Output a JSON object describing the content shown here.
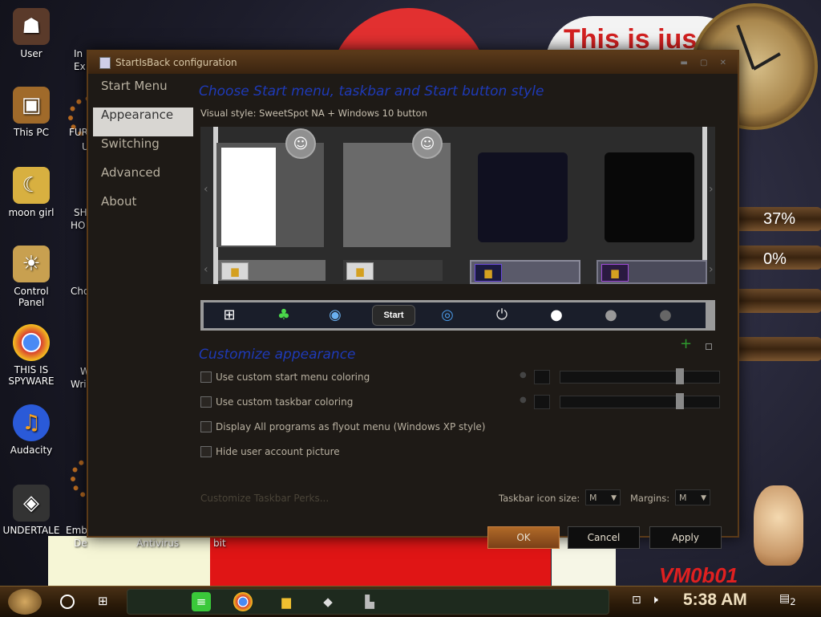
{
  "desktop": {
    "icons_left": [
      {
        "label": "User",
        "icon": "user-folder-icon",
        "color": "#5a3a2a"
      },
      {
        "label": "This PC",
        "icon": "this-pc-icon",
        "color": "#a06a2a"
      },
      {
        "label": "moon girl",
        "icon": "moon-girl-icon",
        "color": "#d8b040"
      },
      {
        "label": "Control Panel",
        "icon": "control-panel-icon",
        "color": "#c8a050"
      },
      {
        "label": "THIS IS SPYWARE",
        "icon": "chrome-icon",
        "color": "#2a8a3a"
      },
      {
        "label": "Audacity",
        "icon": "audacity-icon",
        "color": "#2a5ad8"
      },
      {
        "label": "UNDERTALE",
        "icon": "unity-icon",
        "color": "#333333"
      }
    ],
    "partial_labels": [
      "In",
      "Ex",
      "FUR",
      "U",
      "SH",
      "HO",
      "Cho",
      "W",
      "Wri",
      "Emb",
      "De",
      "Antivirus",
      "bit"
    ],
    "wallpaper_text": "This is jus",
    "gauge_values": [
      "37%",
      "0%"
    ],
    "vm_text": "VM0b01"
  },
  "dialog": {
    "title": "StartIsBack configuration",
    "nav": [
      "Start Menu",
      "Appearance",
      "Switching",
      "Advanced",
      "About"
    ],
    "active_nav": "Appearance",
    "section1_title": "Choose Start menu, taskbar and Start button style",
    "visual_style_line": "Visual style:  SweetSpot NA + Windows 10 button",
    "start_button_styles": [
      "windows-10-flag",
      "clover-orb",
      "windows-7-orb",
      "start-xp",
      "ring-orb",
      "power-icon",
      "white-orb",
      "gray-orb",
      "dark-orb"
    ],
    "start_label": "Start",
    "section2_title": "Customize appearance",
    "options": [
      {
        "label": "Use custom start menu coloring",
        "checked": false
      },
      {
        "label": "Use custom taskbar coloring",
        "checked": false
      },
      {
        "label": "Display All programs as flyout menu (Windows XP style)",
        "checked": false
      },
      {
        "label": "Hide user account picture",
        "checked": false
      }
    ],
    "perks_link": "Customize Taskbar Perks...",
    "icon_size_label": "Taskbar icon size:",
    "icon_size_value": "M",
    "margins_label": "Margins:",
    "margins_value": "M",
    "ok_label": "OK",
    "cancel_label": "Cancel",
    "apply_label": "Apply"
  },
  "taskbar": {
    "time": "5:38 AM",
    "notification_count": "2",
    "pinned": [
      "notes-icon",
      "chrome-icon",
      "file-explorer-icon",
      "roblox-icon",
      "startisback-icon"
    ]
  }
}
